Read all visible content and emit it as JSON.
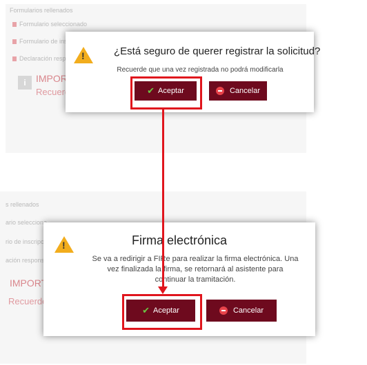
{
  "top_background": {
    "section_title": "Formularios rellenados",
    "items": [
      "Formulario seleccionado",
      "Formulario de inscripción",
      "Declaración responsable"
    ],
    "important_label": "IMPORTA",
    "remember_label": "Recuerde"
  },
  "bottom_background": {
    "section_title": "s rellenados",
    "items": [
      "ario selecciona",
      "rio de inscripci",
      "ación responsab"
    ],
    "important_label": "IMPORTA",
    "remember_label": "Recuerde"
  },
  "dialog_confirm": {
    "title": "¿Está seguro de querer registrar la solicitud?",
    "message": "Recuerde que una vez registrada no podrá modificarla",
    "accept_label": "Aceptar",
    "cancel_label": "Cancelar"
  },
  "dialog_signature": {
    "title": "Firma electrónica",
    "message": "Se va a redirigir a FIRe para realizar la firma electrónica. Una vez finalizada la firma, se retornará al asistente para continuar la tramitación.",
    "accept_label": "Aceptar",
    "cancel_label": "Cancelar"
  },
  "icons": {
    "warning": "warning-triangle-icon",
    "accept": "check-icon",
    "cancel": "minus-circle-icon",
    "info": "info-icon"
  },
  "colors": {
    "button_bg": "#6e0a1e",
    "highlight": "#e0151d",
    "warning": "#f2ad1d",
    "check": "#6cc644",
    "cancel_icon": "#e8434a"
  }
}
